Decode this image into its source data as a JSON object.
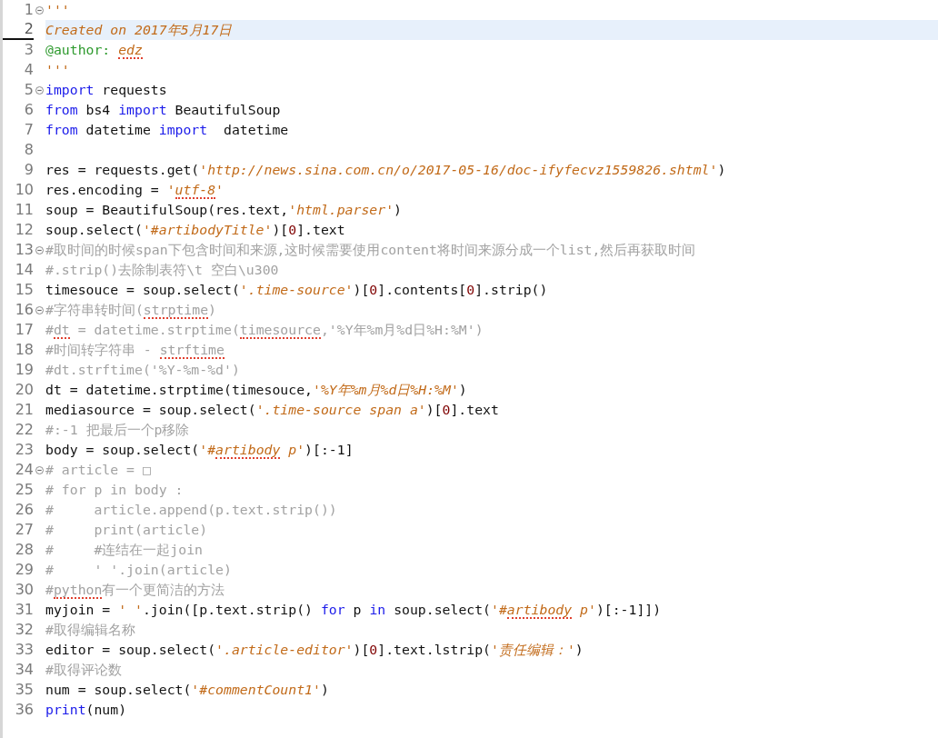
{
  "editor": {
    "lines": [
      {
        "number": "1",
        "foldable": true,
        "current": false,
        "tokens": [
          {
            "kind": "docstring",
            "text": "'''",
            "misspelled": false
          }
        ]
      },
      {
        "number": "2",
        "foldable": false,
        "current": true,
        "tokens": [
          {
            "kind": "docstring",
            "text": "Created on 2017年5月17日",
            "misspelled": false
          }
        ]
      },
      {
        "number": "3",
        "foldable": false,
        "current": false,
        "tokens": [
          {
            "kind": "decorator",
            "text": "@author: ",
            "misspelled": false
          },
          {
            "kind": "docstring",
            "text": "edz",
            "misspelled": true
          }
        ]
      },
      {
        "number": "4",
        "foldable": false,
        "current": false,
        "tokens": [
          {
            "kind": "docstring",
            "text": "'''",
            "misspelled": false
          }
        ]
      },
      {
        "number": "5",
        "foldable": true,
        "current": false,
        "tokens": [
          {
            "kind": "keyword",
            "text": "import",
            "misspelled": false
          },
          {
            "kind": "plain",
            "text": " requests",
            "misspelled": false
          }
        ]
      },
      {
        "number": "6",
        "foldable": false,
        "current": false,
        "tokens": [
          {
            "kind": "keyword",
            "text": "from",
            "misspelled": false
          },
          {
            "kind": "plain",
            "text": " bs4 ",
            "misspelled": false
          },
          {
            "kind": "keyword",
            "text": "import",
            "misspelled": false
          },
          {
            "kind": "plain",
            "text": " BeautifulSoup",
            "misspelled": false
          }
        ]
      },
      {
        "number": "7",
        "foldable": false,
        "current": false,
        "tokens": [
          {
            "kind": "keyword",
            "text": "from",
            "misspelled": false
          },
          {
            "kind": "plain",
            "text": " datetime ",
            "misspelled": false
          },
          {
            "kind": "keyword",
            "text": "import",
            "misspelled": false
          },
          {
            "kind": "plain",
            "text": "  datetime",
            "misspelled": false
          }
        ]
      },
      {
        "number": "8",
        "foldable": false,
        "current": false
      },
      {
        "number": "9",
        "foldable": false,
        "current": false,
        "tokens": [
          {
            "kind": "plain",
            "text": "res = requests.get(",
            "misspelled": false
          },
          {
            "kind": "string",
            "text": "'http://news.sina.com.cn/o/2017-05-16/doc-ifyfecvz1559826.shtml'",
            "misspelled": false
          },
          {
            "kind": "plain",
            "text": ")",
            "misspelled": false
          }
        ]
      },
      {
        "number": "10",
        "foldable": false,
        "current": false,
        "tokens": [
          {
            "kind": "plain",
            "text": "res.encoding = ",
            "misspelled": false
          },
          {
            "kind": "string",
            "text": "'",
            "misspelled": false
          },
          {
            "kind": "string",
            "text": "utf-8",
            "misspelled": true
          },
          {
            "kind": "string",
            "text": "'",
            "misspelled": false
          }
        ]
      },
      {
        "number": "11",
        "foldable": false,
        "current": false,
        "tokens": [
          {
            "kind": "plain",
            "text": "soup = BeautifulSoup(res.text,",
            "misspelled": false
          },
          {
            "kind": "string",
            "text": "'html.parser'",
            "misspelled": false
          },
          {
            "kind": "plain",
            "text": ")",
            "misspelled": false
          }
        ]
      },
      {
        "number": "12",
        "foldable": false,
        "current": false,
        "tokens": [
          {
            "kind": "plain",
            "text": "soup.select(",
            "misspelled": false
          },
          {
            "kind": "string",
            "text": "'#artibodyTitle'",
            "misspelled": false
          },
          {
            "kind": "plain",
            "text": ")[",
            "misspelled": false
          },
          {
            "kind": "number",
            "text": "0",
            "misspelled": false
          },
          {
            "kind": "plain",
            "text": "].text",
            "misspelled": false
          }
        ]
      },
      {
        "number": "13",
        "foldable": true,
        "current": false,
        "tokens": [
          {
            "kind": "comment",
            "text": "#取时间的时候span下包含时间和来源,这时候需要使用content将时间来源分成一个list,然后再获取时间",
            "misspelled": false
          }
        ]
      },
      {
        "number": "14",
        "foldable": false,
        "current": false,
        "tokens": [
          {
            "kind": "comment",
            "text": "#.strip()去除制表符\\t 空白\\u300",
            "misspelled": false
          }
        ]
      },
      {
        "number": "15",
        "foldable": false,
        "current": false,
        "tokens": [
          {
            "kind": "plain",
            "text": "timesouce = soup.select(",
            "misspelled": false
          },
          {
            "kind": "string",
            "text": "'.time-source'",
            "misspelled": false
          },
          {
            "kind": "plain",
            "text": ")[",
            "misspelled": false
          },
          {
            "kind": "number",
            "text": "0",
            "misspelled": false
          },
          {
            "kind": "plain",
            "text": "].contents[",
            "misspelled": false
          },
          {
            "kind": "number",
            "text": "0",
            "misspelled": false
          },
          {
            "kind": "plain",
            "text": "].strip()",
            "misspelled": false
          }
        ]
      },
      {
        "number": "16",
        "foldable": true,
        "current": false,
        "tokens": [
          {
            "kind": "comment",
            "text": "#字符串转时间(",
            "misspelled": false
          },
          {
            "kind": "comment",
            "text": "strptime",
            "misspelled": true
          },
          {
            "kind": "comment",
            "text": ")",
            "misspelled": false
          }
        ]
      },
      {
        "number": "17",
        "foldable": false,
        "current": false,
        "tokens": [
          {
            "kind": "comment",
            "text": "#",
            "misspelled": false
          },
          {
            "kind": "comment",
            "text": "dt",
            "misspelled": true
          },
          {
            "kind": "comment",
            "text": " = datetime.strptime(",
            "misspelled": false
          },
          {
            "kind": "comment",
            "text": "timesource",
            "misspelled": true
          },
          {
            "kind": "comment",
            "text": ",'%Y年%m月%d日%H:%M')",
            "misspelled": false
          }
        ]
      },
      {
        "number": "18",
        "foldable": false,
        "current": false,
        "tokens": [
          {
            "kind": "comment",
            "text": "#时间转字符串 - ",
            "misspelled": false
          },
          {
            "kind": "comment",
            "text": "strftime",
            "misspelled": true
          }
        ]
      },
      {
        "number": "19",
        "foldable": false,
        "current": false,
        "tokens": [
          {
            "kind": "comment",
            "text": "#dt.strftime('%Y-%m-%d')",
            "misspelled": false
          }
        ]
      },
      {
        "number": "20",
        "foldable": false,
        "current": false,
        "tokens": [
          {
            "kind": "plain",
            "text": "dt = datetime.strptime(timesouce,",
            "misspelled": false
          },
          {
            "kind": "string",
            "text": "'%Y年%m月%d日%H:%M'",
            "misspelled": false
          },
          {
            "kind": "plain",
            "text": ")",
            "misspelled": false
          }
        ]
      },
      {
        "number": "21",
        "foldable": false,
        "current": false,
        "tokens": [
          {
            "kind": "plain",
            "text": "mediasource = soup.select(",
            "misspelled": false
          },
          {
            "kind": "string",
            "text": "'.time-source span a'",
            "misspelled": false
          },
          {
            "kind": "plain",
            "text": ")[",
            "misspelled": false
          },
          {
            "kind": "number",
            "text": "0",
            "misspelled": false
          },
          {
            "kind": "plain",
            "text": "].text",
            "misspelled": false
          }
        ]
      },
      {
        "number": "22",
        "foldable": false,
        "current": false,
        "tokens": [
          {
            "kind": "comment",
            "text": "#:-1 把最后一个p移除",
            "misspelled": false
          }
        ]
      },
      {
        "number": "23",
        "foldable": false,
        "current": false,
        "tokens": [
          {
            "kind": "plain",
            "text": "body = soup.select(",
            "misspelled": false
          },
          {
            "kind": "string",
            "text": "'#",
            "misspelled": false
          },
          {
            "kind": "string",
            "text": "artibody",
            "misspelled": true
          },
          {
            "kind": "string",
            "text": " p'",
            "misspelled": false
          },
          {
            "kind": "plain",
            "text": ")[:-1]",
            "misspelled": false
          }
        ]
      },
      {
        "number": "24",
        "foldable": true,
        "current": false,
        "tokens": [
          {
            "kind": "comment",
            "text": "# article = □",
            "misspelled": false
          }
        ]
      },
      {
        "number": "25",
        "foldable": false,
        "current": false,
        "tokens": [
          {
            "kind": "comment",
            "text": "# for p in body :",
            "misspelled": false
          }
        ]
      },
      {
        "number": "26",
        "foldable": false,
        "current": false,
        "tokens": [
          {
            "kind": "comment",
            "text": "#     article.append(p.text.strip())",
            "misspelled": false
          }
        ]
      },
      {
        "number": "27",
        "foldable": false,
        "current": false,
        "tokens": [
          {
            "kind": "comment",
            "text": "#     print(article)",
            "misspelled": false
          }
        ]
      },
      {
        "number": "28",
        "foldable": false,
        "current": false,
        "tokens": [
          {
            "kind": "comment",
            "text": "#     #连结在一起join",
            "misspelled": false
          }
        ]
      },
      {
        "number": "29",
        "foldable": false,
        "current": false,
        "tokens": [
          {
            "kind": "comment",
            "text": "#     ' '.join(article)",
            "misspelled": false
          }
        ]
      },
      {
        "number": "30",
        "foldable": false,
        "current": false,
        "tokens": [
          {
            "kind": "comment",
            "text": "#",
            "misspelled": false
          },
          {
            "kind": "comment",
            "text": "python",
            "misspelled": true
          },
          {
            "kind": "comment",
            "text": "有一个更简洁的方法",
            "misspelled": false
          }
        ]
      },
      {
        "number": "31",
        "foldable": false,
        "current": false,
        "tokens": [
          {
            "kind": "plain",
            "text": "myjoin = ",
            "misspelled": false
          },
          {
            "kind": "string",
            "text": "' '",
            "misspelled": false
          },
          {
            "kind": "plain",
            "text": ".join([p.text.strip() ",
            "misspelled": false
          },
          {
            "kind": "keyword",
            "text": "for",
            "misspelled": false
          },
          {
            "kind": "plain",
            "text": " p ",
            "misspelled": false
          },
          {
            "kind": "keyword",
            "text": "in",
            "misspelled": false
          },
          {
            "kind": "plain",
            "text": " soup.select(",
            "misspelled": false
          },
          {
            "kind": "string",
            "text": "'#",
            "misspelled": false
          },
          {
            "kind": "string",
            "text": "artibody",
            "misspelled": true
          },
          {
            "kind": "string",
            "text": " p'",
            "misspelled": false
          },
          {
            "kind": "plain",
            "text": ")[:-1]])",
            "misspelled": false
          }
        ]
      },
      {
        "number": "32",
        "foldable": false,
        "current": false,
        "tokens": [
          {
            "kind": "comment",
            "text": "#取得编辑名称",
            "misspelled": false
          }
        ]
      },
      {
        "number": "33",
        "foldable": false,
        "current": false,
        "tokens": [
          {
            "kind": "plain",
            "text": "editor = soup.select(",
            "misspelled": false
          },
          {
            "kind": "string",
            "text": "'.article-editor'",
            "misspelled": false
          },
          {
            "kind": "plain",
            "text": ")[",
            "misspelled": false
          },
          {
            "kind": "number",
            "text": "0",
            "misspelled": false
          },
          {
            "kind": "plain",
            "text": "].text.lstrip(",
            "misspelled": false
          },
          {
            "kind": "string",
            "text": "'责任编辑：'",
            "misspelled": false
          },
          {
            "kind": "plain",
            "text": ")",
            "misspelled": false
          }
        ]
      },
      {
        "number": "34",
        "foldable": false,
        "current": false,
        "tokens": [
          {
            "kind": "comment",
            "text": "#取得评论数",
            "misspelled": false
          }
        ]
      },
      {
        "number": "35",
        "foldable": false,
        "current": false,
        "tokens": [
          {
            "kind": "plain",
            "text": "num = soup.select(",
            "misspelled": false
          },
          {
            "kind": "string",
            "text": "'#commentCount1'",
            "misspelled": false
          },
          {
            "kind": "plain",
            "text": ")",
            "misspelled": false
          }
        ]
      },
      {
        "number": "36",
        "foldable": false,
        "current": false,
        "tokens": [
          {
            "kind": "keyword",
            "text": "print",
            "misspelled": false
          },
          {
            "kind": "plain",
            "text": "(num)",
            "misspelled": false
          }
        ]
      }
    ]
  }
}
